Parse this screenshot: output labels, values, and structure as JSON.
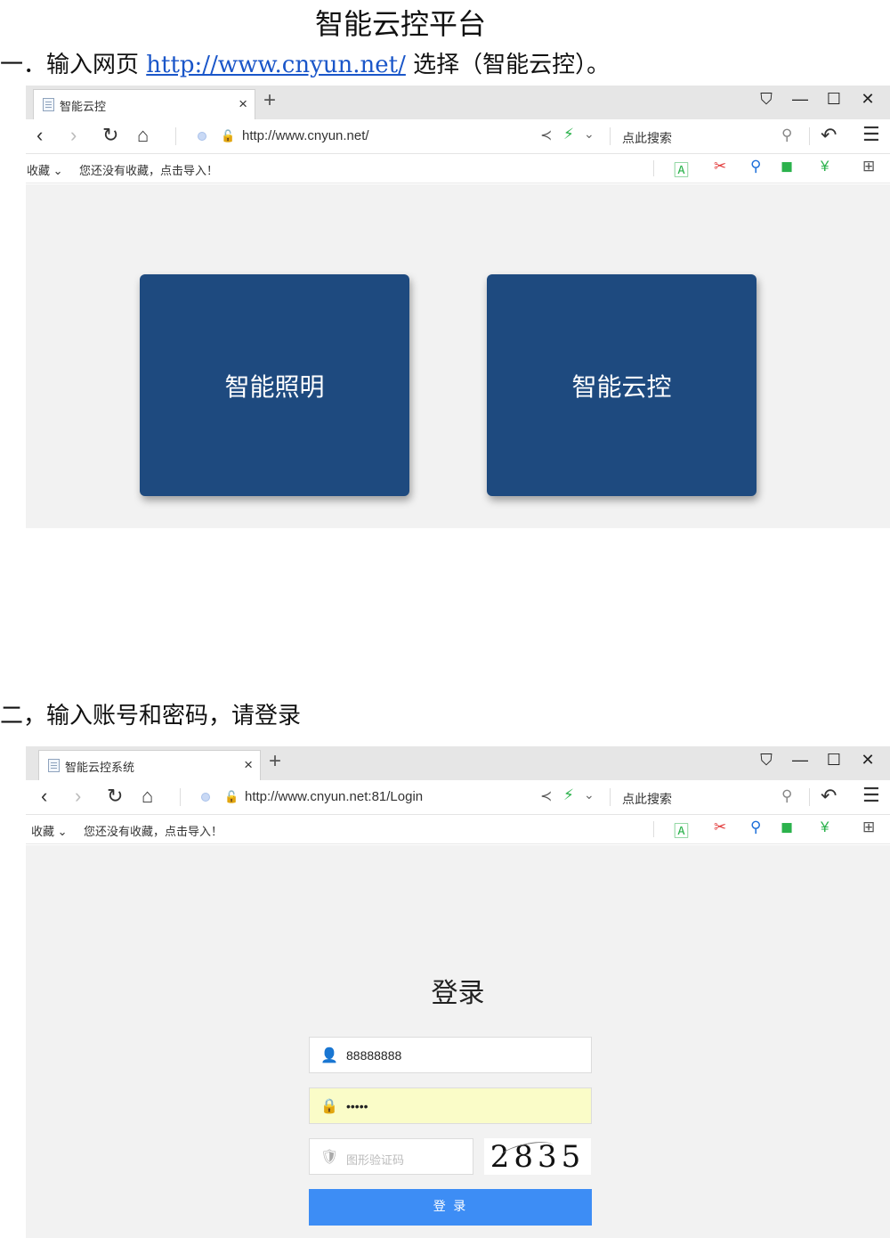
{
  "document": {
    "title": "智能云控平台",
    "step1": {
      "prefix": "一．输入网页 ",
      "link": "http://www.cnyun.net/",
      "suffix": " 选择（智能云控）。"
    },
    "step2": {
      "text": "二，输入账号和密码，请登录"
    }
  },
  "browser1": {
    "tab_title": "智能云控",
    "url": "http://www.cnyun.net/",
    "search_label": "点此搜索",
    "bookmarks_label": "收藏 ⌄",
    "bookmarks_hint": "您还没有收藏，点击导入！",
    "cards": [
      "智能照明",
      "智能云控"
    ]
  },
  "browser2": {
    "tab_title": "智能云控系统",
    "url": "http://www.cnyun.net:81/Login",
    "search_label": "点此搜索",
    "bookmarks_label": "收藏 ⌄",
    "bookmarks_hint": "您还没有收藏，点击导入！",
    "login": {
      "title": "登录",
      "username_value": "88888888",
      "password_value": "•••••",
      "captcha_placeholder": "图形验证码",
      "captcha_text": "2835",
      "submit_label": "登 录"
    }
  },
  "colors": {
    "card_bg": "#1e4a7f",
    "login_button": "#3d8df5",
    "password_field_bg": "#fafcc8",
    "link": "#1a56c9"
  }
}
